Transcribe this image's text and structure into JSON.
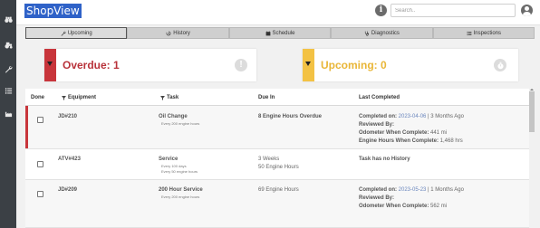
{
  "app": {
    "title": "ShopView"
  },
  "header": {
    "search_placeholder": "Search..",
    "info_label": "i"
  },
  "sidebar": {
    "icons": [
      "binoculars-icon",
      "tractor-icon",
      "wrench-icon",
      "list-icon",
      "factory-icon"
    ]
  },
  "tabs": [
    {
      "label": "Upcoming",
      "icon": "wrench-icon",
      "active": true
    },
    {
      "label": "History",
      "icon": "history-icon",
      "active": false
    },
    {
      "label": "Schedule",
      "icon": "calendar-icon",
      "active": false
    },
    {
      "label": "Diagnostics",
      "icon": "stethoscope-icon",
      "active": false
    },
    {
      "label": "Inspections",
      "icon": "checklist-icon",
      "active": false
    }
  ],
  "cards": {
    "overdue": {
      "label": "Overdue: 1",
      "icon_text": "!",
      "color": "#c8353b"
    },
    "upcoming": {
      "label": "Upcoming: 0",
      "icon_text": "⏱",
      "color": "#f3c244"
    }
  },
  "table": {
    "columns": {
      "done": "Done",
      "equipment": "Equipment",
      "task": "Task",
      "due_in": "Due In",
      "last_completed": "Last Completed"
    },
    "rows": [
      {
        "equipment": "JD#210",
        "task": "Oil Change",
        "task_sub": [
          "Every 200 engine hours"
        ],
        "due": [
          "8 Engine Hours Overdue"
        ],
        "due_bold": true,
        "completed_on_label": "Completed on:",
        "completed_on_date": "2023-04-06",
        "completed_on_ago": " | 3 Months Ago",
        "reviewed_by": "Reviewed By:",
        "odometer_label": "Odometer When Complete:",
        "odometer_value": " 441 mi",
        "hours_label": "Engine Hours When Complete:",
        "hours_value": " 1,468 hrs",
        "overdue": true
      },
      {
        "equipment": "ATV#423",
        "task": "Service",
        "task_sub": [
          "Every 100 days",
          "Every 50 engine hours"
        ],
        "due": [
          "3 Weeks",
          "50 Engine Hours"
        ],
        "due_bold": false,
        "no_history": "Task has no History",
        "overdue": false
      },
      {
        "equipment": "JD#209",
        "task": "200 Hour Service",
        "task_sub": [
          "Every 200 engine hours"
        ],
        "due": [
          "69 Engine Hours"
        ],
        "due_bold": false,
        "completed_on_label": "Completed on:",
        "completed_on_date": "2023-05-23",
        "completed_on_ago": " | 1 Months Ago",
        "reviewed_by": "Reviewed By:",
        "odometer_label": "Odometer When Complete:",
        "odometer_value": " 562 mi",
        "overdue": false
      }
    ]
  }
}
